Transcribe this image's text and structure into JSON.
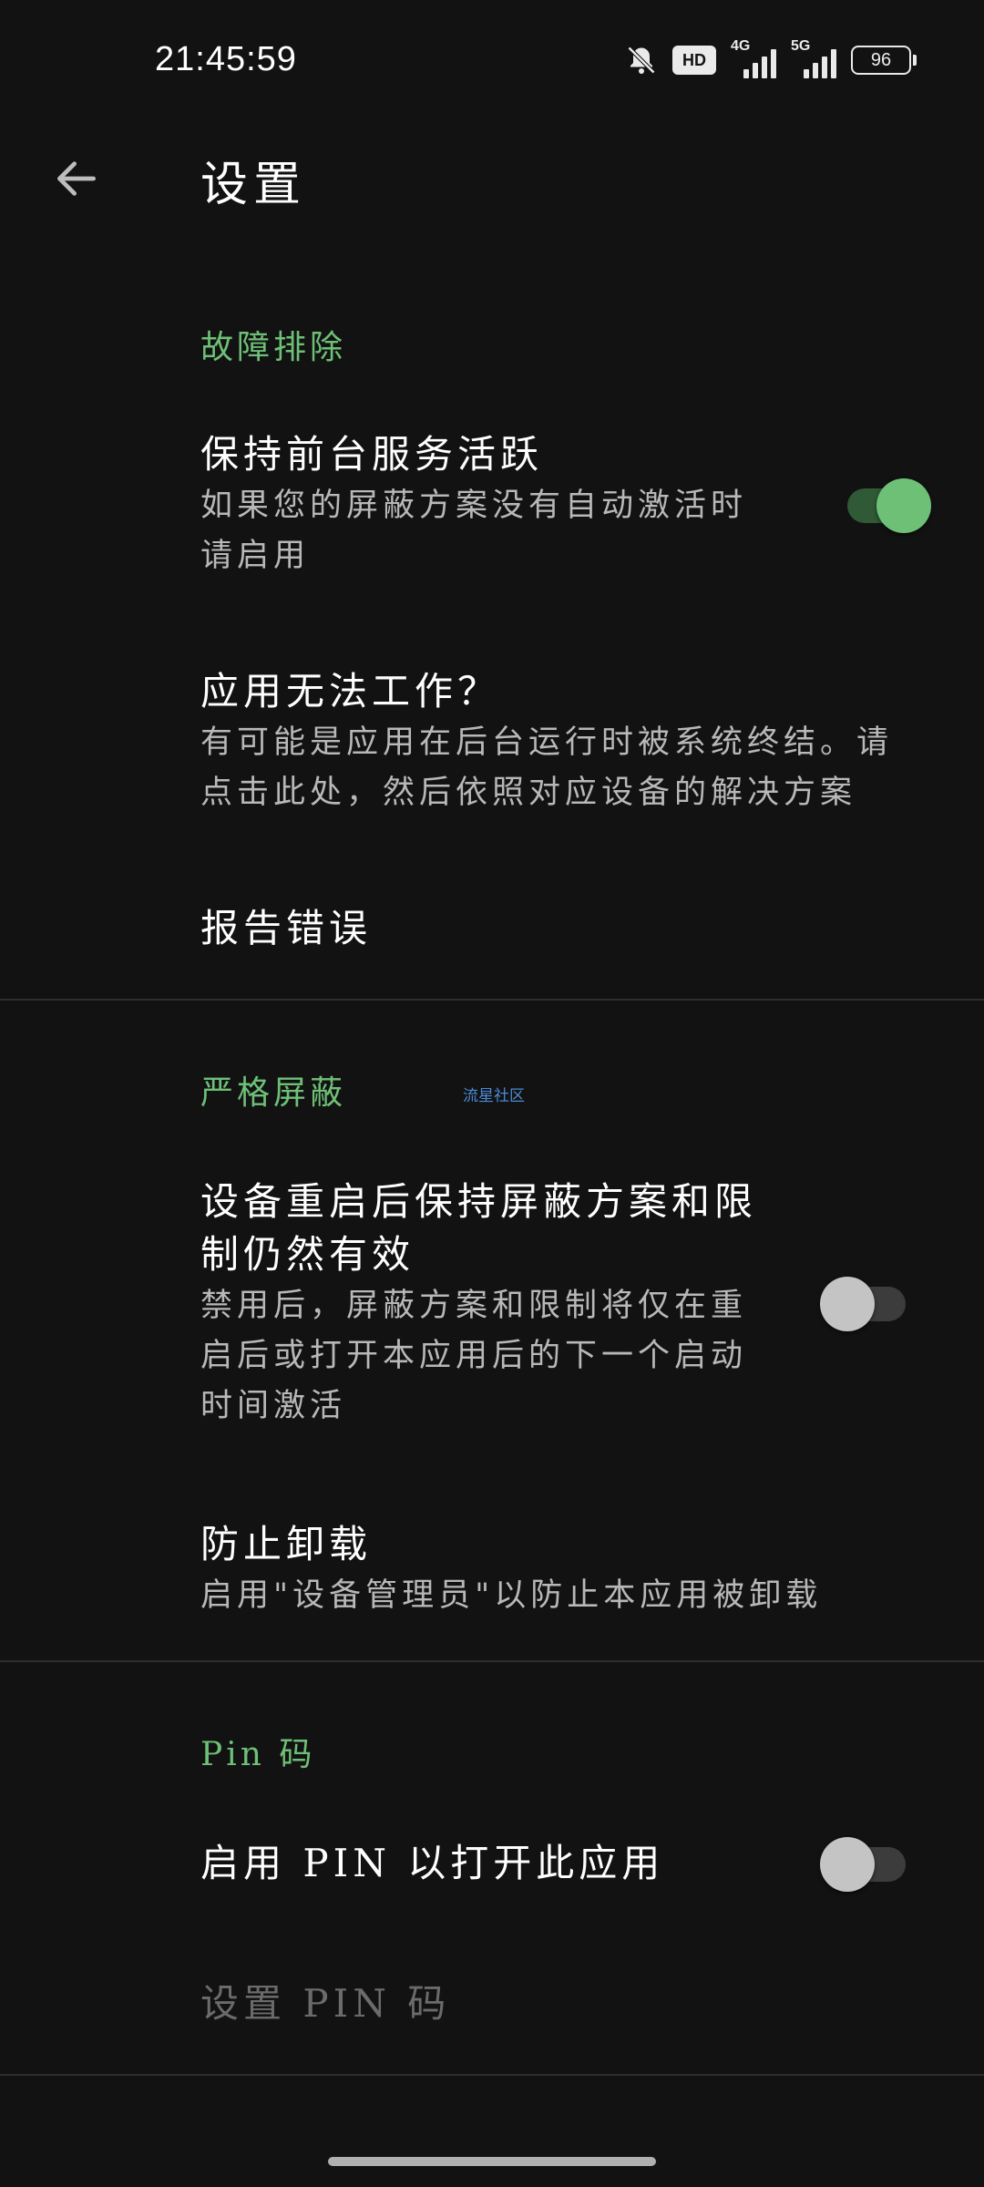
{
  "status_bar": {
    "time": "21:45:59",
    "icons": [
      "bell-off-icon",
      "hd-voice-icon",
      "signal-4g-icon",
      "signal-5g-icon",
      "battery-icon"
    ],
    "hd_label": "HD",
    "signal_1_label": "4G",
    "signal_2_label": "5G",
    "battery_level": "96"
  },
  "app_bar": {
    "title": "设置",
    "back_icon": "arrow-left-icon"
  },
  "sections": {
    "troubleshooting": {
      "header": "故障排除",
      "keep_foreground": {
        "title": "保持前台服务活跃",
        "summary": "如果您的屏蔽方案没有自动激活时\n请启用",
        "enabled": true
      },
      "app_not_working": {
        "title": "应用无法工作？",
        "summary": "有可能是应用在后台运行时被系统终结。请\n点击此处，然后依照对应设备的解决方案"
      },
      "report_bug": {
        "title": "报告错误"
      }
    },
    "strict_block": {
      "header": "严格屏蔽",
      "watermark": "流星社区",
      "keep_after_reboot": {
        "title": "设备重启后保持屏蔽方案和限\n制仍然有效",
        "summary": "禁用后，屏蔽方案和限制将仅在重\n启后或打开本应用后的下一个启动\n时间激活",
        "enabled": false
      },
      "prevent_uninstall": {
        "title": "防止卸载",
        "summary": "启用\"设备管理员\"以防止本应用被卸载"
      }
    },
    "pin": {
      "header": "Pin 码",
      "enable_pin": {
        "title": "启用 PIN 以打开此应用",
        "enabled": false
      },
      "set_pin": {
        "title": "设置 PIN 码",
        "disabled": true
      }
    }
  },
  "colors": {
    "background": "#121212",
    "accent": "#6ec077",
    "text_primary": "#ffffff",
    "text_secondary": "#b8b8b8",
    "text_disabled": "#6b6b6b",
    "divider": "#2e2e2e"
  }
}
